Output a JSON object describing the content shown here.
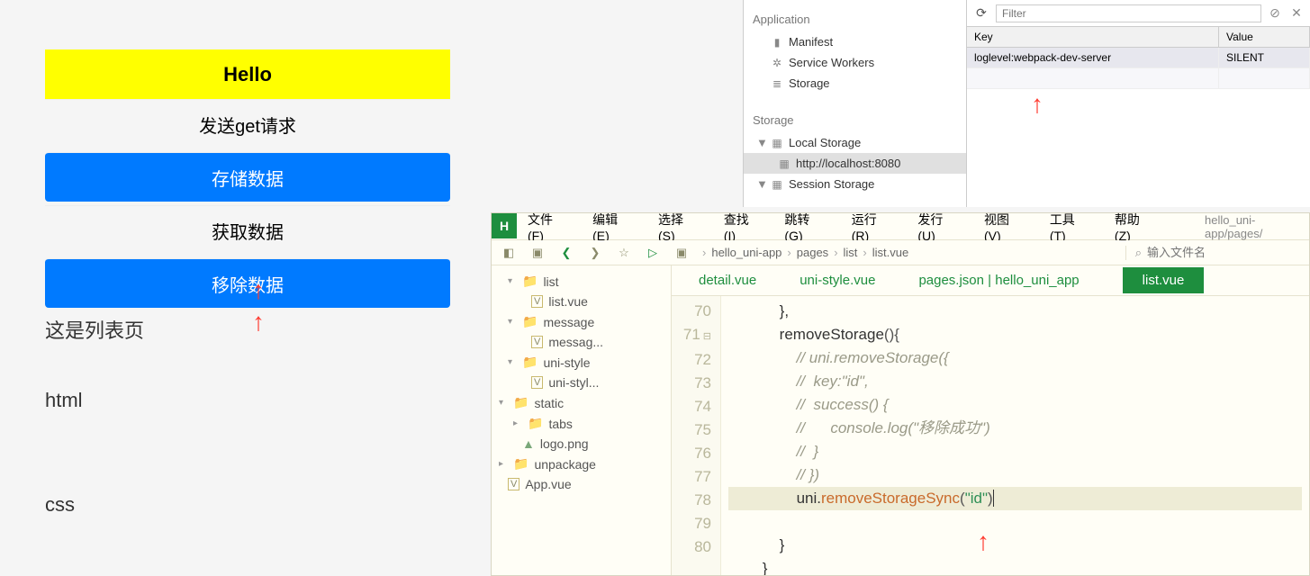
{
  "app": {
    "title": "Hello",
    "rows": {
      "get": "发送get请求",
      "store": "存储数据",
      "fetch": "获取数据",
      "remove": "移除数据"
    },
    "texts": {
      "listPage": "这是列表页",
      "html": "html",
      "css": "css"
    }
  },
  "devtools": {
    "section_application": "Application",
    "items": {
      "manifest": "Manifest",
      "sw": "Service Workers",
      "storage": "Storage"
    },
    "section_storage": "Storage",
    "tree": {
      "local": "Local Storage",
      "local_child": "http://localhost:8080",
      "session": "Session Storage"
    },
    "filter_placeholder": "Filter",
    "cols": {
      "key": "Key",
      "value": "Value"
    },
    "row1": {
      "key": "loglevel:webpack-dev-server",
      "value": "SILENT"
    }
  },
  "ide": {
    "menus": {
      "file": "文件(F)",
      "edit": "编辑(E)",
      "select": "选择(S)",
      "find": "查找(I)",
      "goto": "跳转(G)",
      "run": "运行(R)",
      "publish": "发行(U)",
      "view": "视图(V)",
      "tool": "工具(T)",
      "help": "帮助(Z)"
    },
    "proj_path": "hello_uni-app/pages/",
    "breadcrumb": {
      "p1": "hello_uni-app",
      "p2": "pages",
      "p3": "list",
      "p4": "list.vue"
    },
    "search_placeholder": "输入文件名",
    "tree": {
      "list": "list",
      "list_vue": "list.vue",
      "message": "message",
      "message_vue": "messag...",
      "uni_style": "uni-style",
      "uni_style_vue": "uni-styl...",
      "static": "static",
      "tabs": "tabs",
      "logo": "logo.png",
      "unpackage": "unpackage",
      "app_vue": "App.vue"
    },
    "tabs": {
      "detail": "detail.vue",
      "unistyle": "uni-style.vue",
      "pagesjson": "pages.json | hello_uni_app",
      "listvue": "list.vue"
    },
    "code": {
      "ln70": "70",
      "ln71": "71",
      "ln72": "72",
      "ln73": "73",
      "ln74": "74",
      "ln75": "75",
      "ln76": "76",
      "ln77": "77",
      "ln78": "78",
      "ln79": "79",
      "ln80": "80",
      "l70": "            },",
      "l71a": "            removeStorage",
      "l71b": "(){",
      "l72": "                // uni.removeStorage({",
      "l73": "                //  key:\"id\",",
      "l74": "                //  success() {",
      "l75": "                //      console.log(\"移除成功\")",
      "l76": "                //  }",
      "l77": "                // })",
      "l78a": "                uni.",
      "l78b": "removeStorageSync",
      "l78c": "(",
      "l78d": "\"id\"",
      "l78e": ")",
      "l79": "            }",
      "l80": "        }"
    }
  }
}
